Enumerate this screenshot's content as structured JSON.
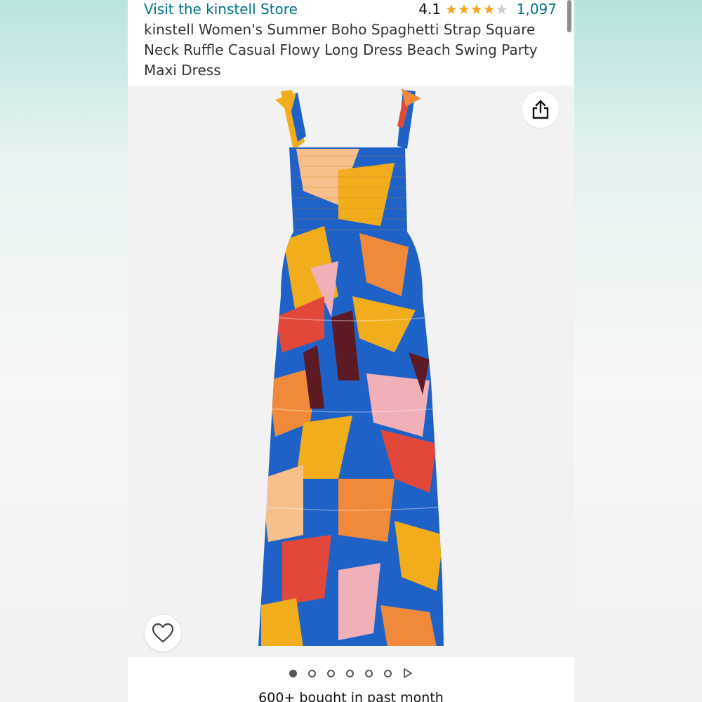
{
  "store": {
    "link_text": "Visit the kinstell Store"
  },
  "rating": {
    "value": "4.1",
    "stars_filled": 4.1,
    "stars_total": 5,
    "count": "1,097"
  },
  "product": {
    "title": "kinstell Women's Summer Boho Spaghetti Strap Square Neck Ruffle Casual Flowy Long Dress Beach Swing Party Maxi Dress"
  },
  "gallery": {
    "image_count": 6,
    "active_index": 0
  },
  "icons": {
    "share": "share-icon",
    "heart": "heart-icon",
    "play": "play-icon"
  },
  "colors": {
    "link": "#007185",
    "star": "#f5a623",
    "dress_blue": "#1f62c7",
    "dress_yellow": "#f2ad1c",
    "dress_orange": "#f08a3a",
    "dress_red": "#e2483a",
    "dress_pink": "#f1b0b8",
    "dress_maroon": "#5e1a22"
  },
  "social_proof": {
    "bought_text": "600+ bought in past month"
  }
}
